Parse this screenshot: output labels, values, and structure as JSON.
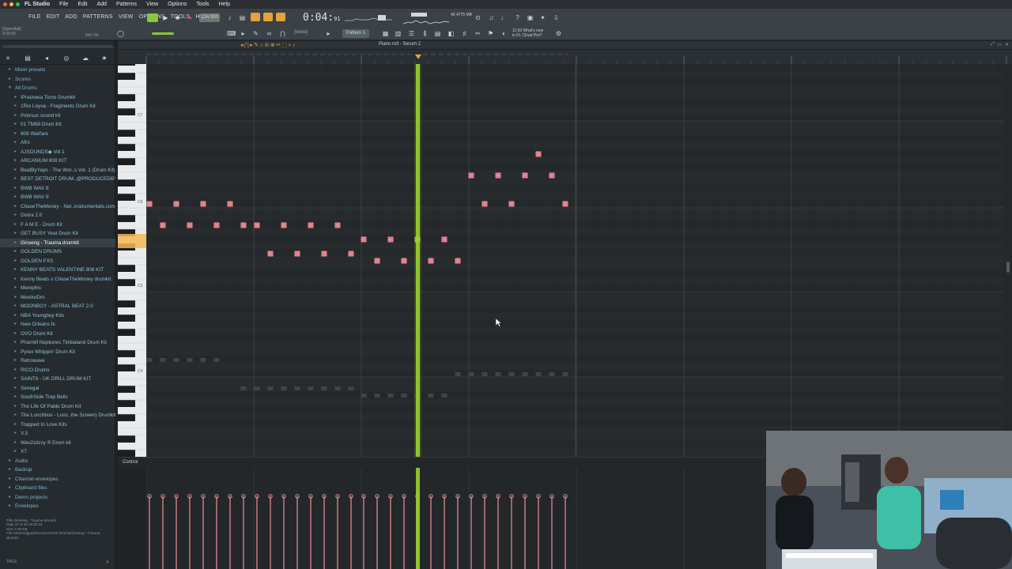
{
  "mac_menu": {
    "app_name": "FL Studio",
    "items": [
      "File",
      "Edit",
      "Add",
      "Patterns",
      "View",
      "Options",
      "Tools",
      "Help"
    ]
  },
  "toolbar": {
    "fl_menu": [
      "FILE",
      "EDIT",
      "ADD",
      "PATTERNS",
      "VIEW",
      "OPTIONS",
      "TOOLS",
      "HELP"
    ],
    "tempo": "124.000",
    "time_main": "0:04:",
    "time_small": "91",
    "pattern": "Pattern 1",
    "snap": "(none)",
    "hint_line1": "[Speedtail]",
    "hint_line2": "4:05:00",
    "cpu": "4775 MB",
    "cpu_small": "48",
    "whats_new_1": "11:03 What's new",
    "whats_new_2": "in FL Cloud Pro?",
    "time_sig": "6/4 / 56"
  },
  "browser": {
    "top_items": [
      {
        "label": "Mixer presets",
        "fold": "▸"
      },
      {
        "label": "Scores",
        "fold": "▸"
      },
      {
        "label": "All Drums",
        "fold": "▾"
      }
    ],
    "items": [
      "!Praizewa Tomo Drumkit",
      "1Rio Leyva - Fragments Drum Kit",
      "0Versus sound kit",
      "01 TM88 Drum Kit",
      "808 Warfare",
      "Afro",
      "AJSOUNDS◆ Vol.1",
      "ARCANIUM 808 KIT",
      "BeatByYayo - The Wor..s Vol. 1 (Drum Kit)",
      "BEST DETROIT DRUM..@PRODUCEDBYAVEN",
      "BWB WAV 8",
      "BWB WAV 9",
      "ChaseTheMoney - Nar..instrumentals.com)",
      "Distra 2.0",
      "F A M E - Drum Kit",
      "GET BUSY Yeat Drum Kit",
      "Ginseng - Trauma drumkit",
      "GOLDEN DRUMS",
      "GOLDEN FXS",
      "KENNY BEATS VALENTINE 808 KIT",
      "Kenny Beats x ChaseTheMoney drumkit",
      "Memphis",
      "MexikoDro",
      "MOONBOY - ASTRAL BEAT 2.0",
      "NBA Youngboy Kits",
      "New Orleans fx",
      "OVO Drum Kit",
      "Pharrell Neptunes Timbaland Drum Kit",
      "Pyrex Whippin' Drum Kit",
      "Retrowave",
      "RICO Drums",
      "SAINT6 - UK DRILL DRUM KIT",
      "Senegal",
      "SouthSide Trap Bells",
      "The Life Of Pablo Drum Kit",
      "The Lunchbox - Lunc..the Screen) Drumkit",
      "Trapped In Love Kits",
      "V.3",
      "Wav2slizzy ® Drum kit",
      "XT"
    ],
    "selected_index": 16,
    "bottom_items": [
      {
        "label": "Audio",
        "fold": "▸"
      },
      {
        "label": "Backup",
        "fold": "▸"
      },
      {
        "label": "Channel envelopes",
        "fold": "▸"
      },
      {
        "label": "Clipboard files",
        "fold": "▸"
      },
      {
        "label": "Demo projects",
        "fold": "▸"
      },
      {
        "label": "Envelopes",
        "fold": "▸"
      }
    ],
    "info": [
      "Title   Ginseng - Trauma drumkit",
      "Date    27-3-26 03:50:31",
      "Size    7.69 KB",
      "File    /Users/djgup/Documents/All Drums/Ginseng - Trauma drumkit"
    ],
    "tags_label": "TAGS"
  },
  "piano_roll": {
    "title": "Piano roll - Serum 2",
    "octave_labels": [
      "C7",
      "C6",
      "C5",
      "C4"
    ],
    "control_label": "Control",
    "note_color": "#f08e9a",
    "ghost_color": "#3f4448",
    "playhead_color": "#9ad12a"
  },
  "colors": {
    "accent_orange": "#e5a23b",
    "note": "#f08e9a",
    "playhead": "#9ad12a"
  }
}
